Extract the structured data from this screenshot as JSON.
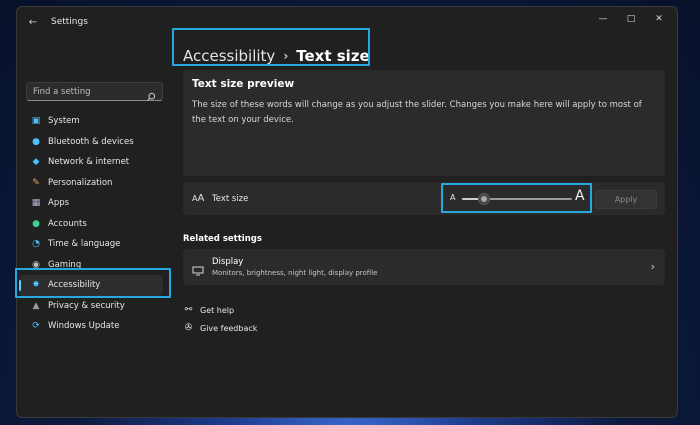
{
  "window": {
    "back_icon": "back-arrow-icon",
    "title": "Settings",
    "controls": [
      "minimize-icon",
      "maximize-icon",
      "close-icon"
    ]
  },
  "search": {
    "placeholder": "Find a setting",
    "icon": "search-icon"
  },
  "sidebar": {
    "items": [
      {
        "label": "System",
        "icon": "monitor-icon",
        "color": "#4cc2ff"
      },
      {
        "label": "Bluetooth & devices",
        "icon": "bluetooth-icon",
        "color": "#4cc2ff"
      },
      {
        "label": "Network & internet",
        "icon": "wifi-icon",
        "color": "#4cc2ff"
      },
      {
        "label": "Personalization",
        "icon": "brush-icon",
        "color": "#f0a35e"
      },
      {
        "label": "Apps",
        "icon": "apps-icon",
        "color": "#b4b4d8"
      },
      {
        "label": "Accounts",
        "icon": "person-icon",
        "color": "#3ecf8e"
      },
      {
        "label": "Time & language",
        "icon": "globe-clock-icon",
        "color": "#4cc2ff"
      },
      {
        "label": "Gaming",
        "icon": "controller-icon",
        "color": "#c0c0c0"
      },
      {
        "label": "Accessibility",
        "icon": "accessibility-icon",
        "color": "#4cc2ff",
        "selected": true
      },
      {
        "label": "Privacy & security",
        "icon": "shield-icon",
        "color": "#9a9a9a"
      },
      {
        "label": "Windows Update",
        "icon": "update-icon",
        "color": "#4cc2ff"
      }
    ]
  },
  "breadcrumb": {
    "parent": "Accessibility",
    "separator": "›",
    "current": "Text size"
  },
  "preview": {
    "title": "Text size preview",
    "body": "The size of these words will change as you adjust the slider. Changes you make here will apply to most of the text on your device."
  },
  "text_size": {
    "icon": "text-size-icon",
    "label": "Text size",
    "small_glyph": "A",
    "large_glyph": "A",
    "slider_value": 0.2,
    "apply_label": "Apply"
  },
  "related": {
    "heading": "Related settings",
    "display": {
      "title": "Display",
      "subtitle": "Monitors, brightness, night light, display profile",
      "icon": "display-icon"
    }
  },
  "help": {
    "get_help": "Get help",
    "feedback": "Give feedback"
  },
  "colors": {
    "accent": "#60cdff",
    "annotation": "#29a8e0"
  }
}
